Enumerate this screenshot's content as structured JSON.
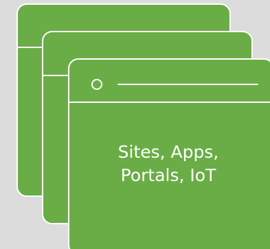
{
  "diagram": {
    "caption_lines": [
      "Sites, Apps,",
      "Portals, IoT"
    ],
    "colors": {
      "background": "#dcdcdc",
      "window_fill": "#6aad46",
      "window_stroke": "#ffffff",
      "text": "#ffffff"
    },
    "windows": [
      {
        "name": "back-window"
      },
      {
        "name": "middle-window"
      },
      {
        "name": "front-window"
      }
    ]
  }
}
